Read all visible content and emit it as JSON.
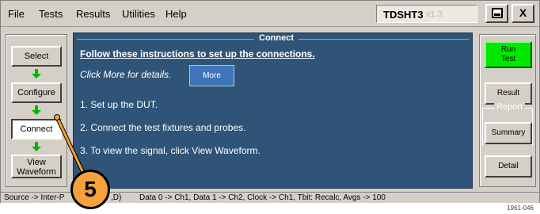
{
  "menubar": {
    "items": [
      "File",
      "Tests",
      "Results",
      "Utilities",
      "Help"
    ],
    "app_name": "TDSHT3",
    "app_version": "v1.3",
    "close_symbol": "X"
  },
  "steps": {
    "select": "Select",
    "configure": "Configure",
    "connect": "Connect",
    "view_line1": "View",
    "view_line2": "Waveform"
  },
  "main": {
    "title": "Connect",
    "heading": "Follow these instructions to set up the connections.",
    "hint": "Click More for details.",
    "more_label": "More",
    "instructions": [
      "1. Set up the DUT.",
      "2. Connect the test fixtures and probes.",
      "3. To view the signal, click View Waveform."
    ]
  },
  "right": {
    "run_line1": "Run",
    "run_line2": "Test",
    "result": "Result",
    "report_group": "Report",
    "summary": "Summary",
    "detail": "Detail"
  },
  "statusbar": {
    "left": "Source -> Inter-P",
    "left_tail": ",D)",
    "right": "Data 0 -> Ch1, Data 1 -> Ch2, Clock -> Ch1, Tbit: Recalc, Avgs -> 100"
  },
  "callout": {
    "number": "5"
  },
  "figure_id": "1961-046",
  "colors": {
    "main_bg": "#2f5478",
    "run_green": "#00e800",
    "arrow_green": "#00b400",
    "callout_orange": "#f5a23c",
    "more_blue": "#3d75b8"
  }
}
